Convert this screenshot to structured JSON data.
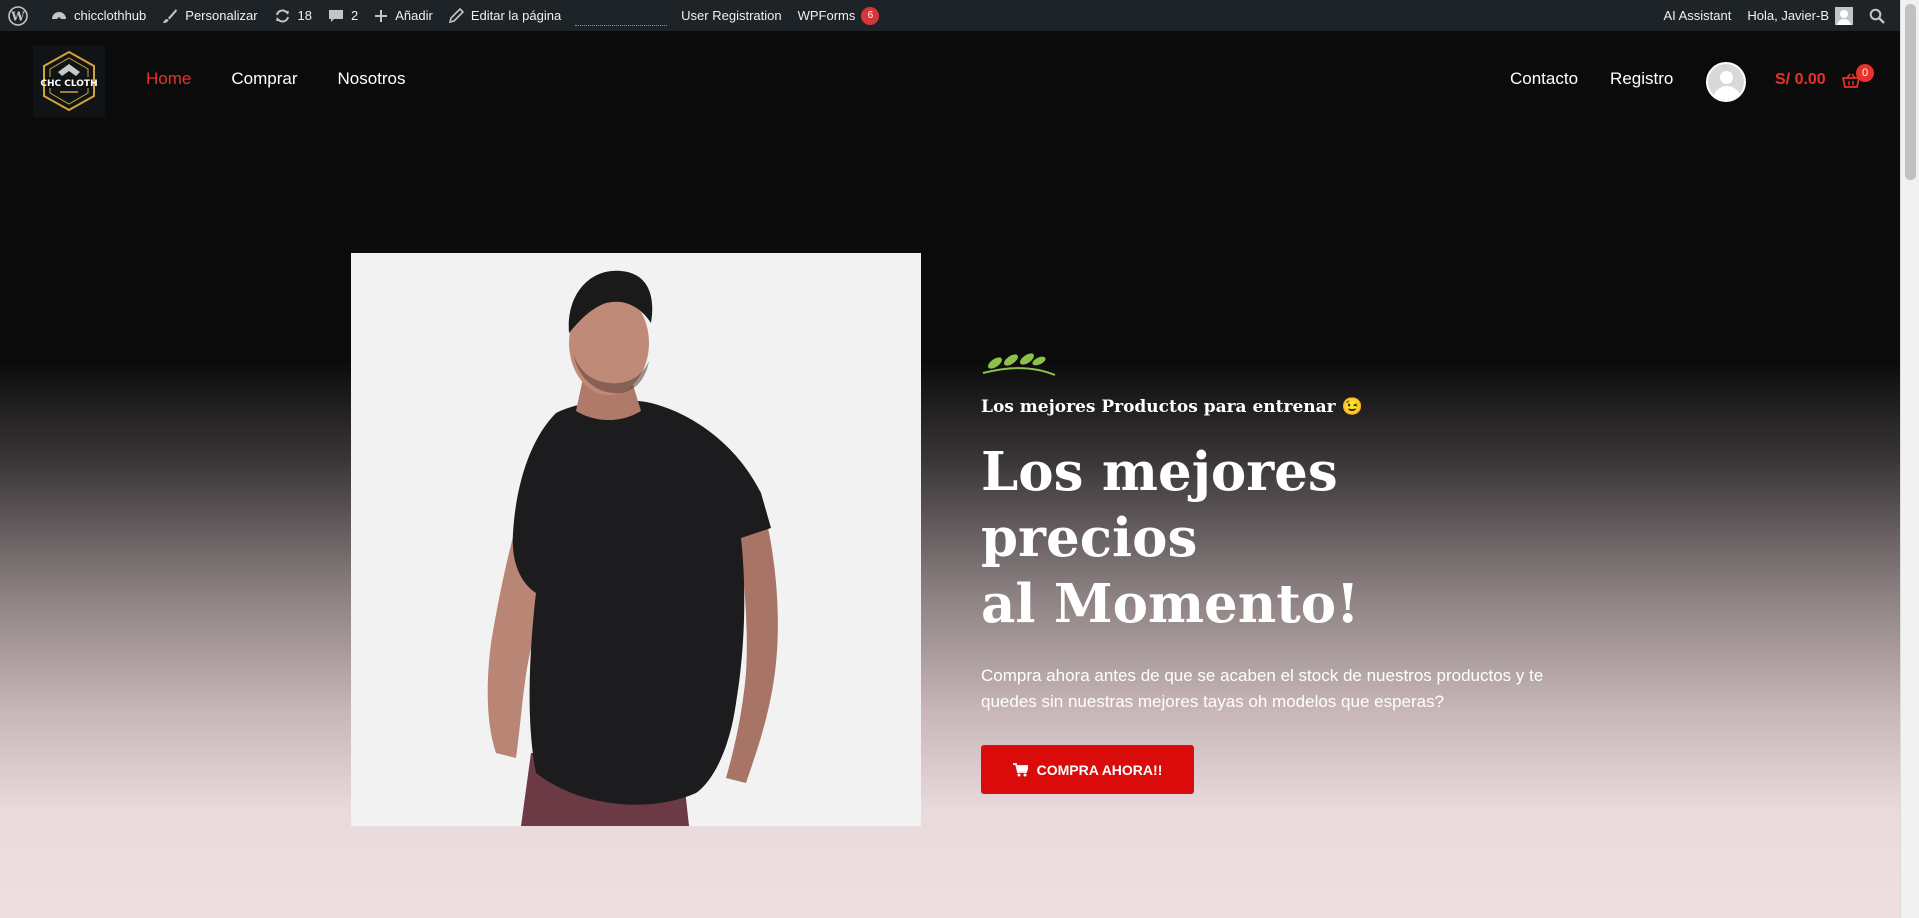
{
  "adminbar": {
    "site_name": "chicclothhub",
    "customize": "Personalizar",
    "updates_count": "18",
    "comments_count": "2",
    "add_new": "Añadir",
    "edit_page": "Editar la página",
    "user_registration": "User Registration",
    "wpforms": "WPForms",
    "wpforms_badge": "6",
    "ai_assistant": "AI Assistant",
    "greeting": "Hola, Javier-B"
  },
  "header": {
    "logo_text": "CHC CLOTH",
    "nav_left": [
      {
        "label": "Home",
        "active": true
      },
      {
        "label": "Comprar",
        "active": false
      },
      {
        "label": "Nosotros",
        "active": false
      }
    ],
    "nav_right": [
      {
        "label": "Contacto"
      },
      {
        "label": "Registro"
      }
    ],
    "cart_total": "S/ 0.00",
    "cart_count": "0"
  },
  "hero": {
    "tagline": "Los mejores Productos para entrenar 😉",
    "headline_line1": "Los mejores precios",
    "headline_line2": "al Momento!",
    "description": "Compra ahora antes de que se acaben el stock de nuestros productos y te quedes sin nuestras mejores tayas oh modelos que esperas?",
    "cta_label": "COMPRA AHORA!!"
  },
  "colors": {
    "accent": "#e8322b",
    "cta": "#d90b0b",
    "adminbar": "#1d2327",
    "leaves": "#8bc34a"
  },
  "icons": [
    "wordpress-icon",
    "dashboard-icon",
    "brush-icon",
    "refresh-icon",
    "comment-icon",
    "plus-icon",
    "pencil-icon",
    "search-icon",
    "cart-icon",
    "user-avatar-icon",
    "leaves-icon"
  ]
}
